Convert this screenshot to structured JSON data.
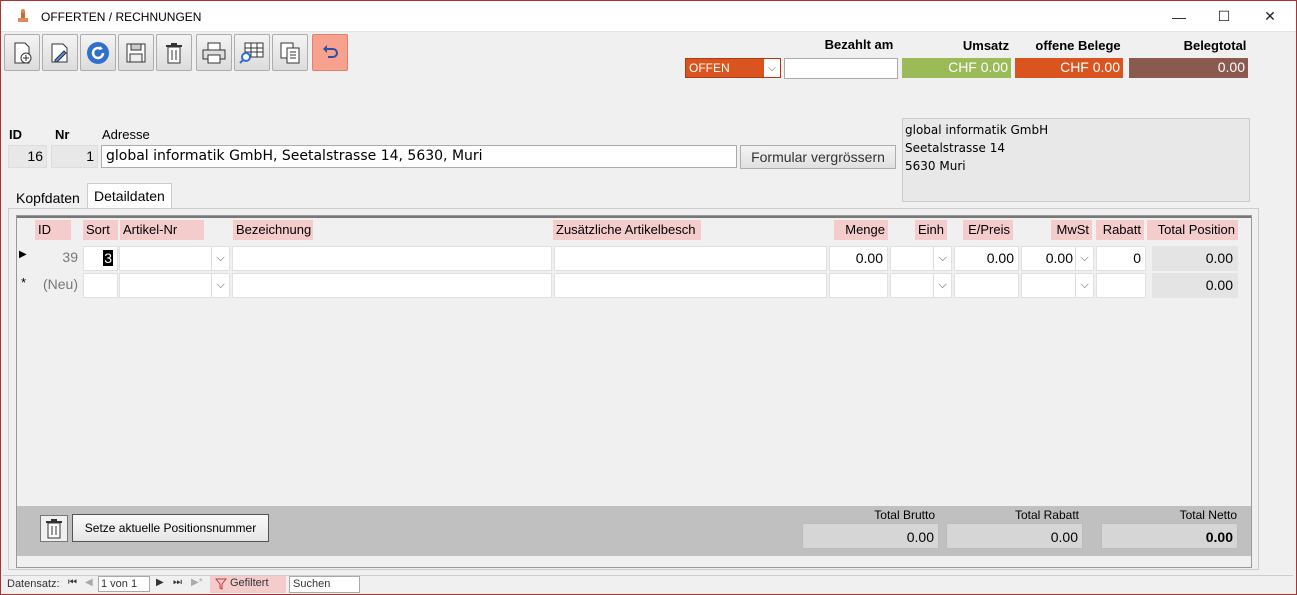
{
  "window": {
    "title": "OFFERTEN / RECHNUNGEN",
    "minimize": "—",
    "maximize": "☐",
    "close": "✕"
  },
  "toolbar": {
    "icons": [
      "new-doc-icon",
      "edit-doc-icon",
      "refresh-icon",
      "save-icon",
      "delete-icon",
      "print-icon",
      "search-grid-icon",
      "copy-icon",
      "undo-icon"
    ]
  },
  "header": {
    "bezahlt_label": "Bezahlt am",
    "umsatz_label": "Umsatz",
    "offene_label": "offene Belege",
    "belegtotal_label": "Belegtotal",
    "status_value": "OFFEN",
    "bezahlt_value": "",
    "umsatz_value": "CHF 0.00",
    "offene_value": "CHF 0.00",
    "belegtotal_value": "0.00",
    "colors": {
      "status": "#d9541e",
      "umsatz": "#9bbb59",
      "offene": "#d9541e",
      "belegtotal": "#8b5a4f"
    }
  },
  "address": {
    "id_label": "ID",
    "nr_label": "Nr",
    "adresse_label": "Adresse",
    "id_value": "16",
    "nr_value": "1",
    "adresse_value": "global informatik GmbH, Seetalstrasse 14, 5630, Muri",
    "enlarge_button": "Formular vergrössern",
    "block_line1": "global informatik GmbH",
    "block_line2": "Seetalstrasse 14",
    "block_line3": "5630 Muri"
  },
  "tabs": {
    "kopf": "Kopfdaten",
    "detail": "Detaildaten"
  },
  "columns": {
    "id": "ID",
    "sort": "Sort",
    "artikel": "Artikel-Nr",
    "bez": "Bezeichnung",
    "zusatz": "Zusätzliche Artikelbesch",
    "menge": "Menge",
    "einh": "Einh",
    "epreis": "E/Preis",
    "mwst": "MwSt",
    "rabatt": "Rabatt",
    "total": "Total Position"
  },
  "rows": [
    {
      "marker": "▶",
      "id": "39",
      "sort": "3",
      "artikel": "",
      "bez": "",
      "zusatz": "",
      "menge": "0.00",
      "einh": "",
      "epreis": "0.00",
      "mwst": "0.00",
      "rabatt": "0",
      "total": "0.00"
    },
    {
      "marker": "*",
      "id": "(Neu)",
      "sort": "",
      "artikel": "",
      "bez": "",
      "zusatz": "",
      "menge": "",
      "einh": "",
      "epreis": "",
      "mwst": "",
      "rabatt": "",
      "total": "0.00"
    }
  ],
  "footer": {
    "set_button": "Setze aktuelle Positionsnummer",
    "brutto_label": "Total Brutto",
    "rabatt_label": "Total Rabatt",
    "netto_label": "Total Netto",
    "brutto_value": "0.00",
    "rabatt_value": "0.00",
    "netto_value": "0.00"
  },
  "statusbar": {
    "datensatz": "Datensatz:",
    "record": "1 von 1",
    "filter": "Gefiltert",
    "search": "Suchen"
  }
}
